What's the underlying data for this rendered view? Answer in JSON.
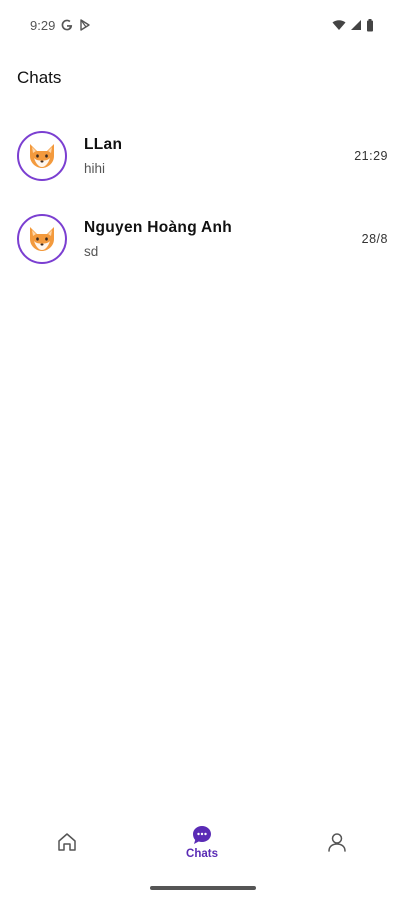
{
  "status_bar": {
    "time": "9:29",
    "left_icons": [
      "google-g-icon",
      "play-store-icon"
    ],
    "right_icons": [
      "wifi-icon",
      "signal-icon",
      "battery-icon"
    ]
  },
  "page": {
    "title": "Chats"
  },
  "chats": [
    {
      "name": "LLan",
      "preview": "hihi",
      "time": "21:29",
      "avatar": "fox-avatar"
    },
    {
      "name": "Nguyen Hoàng Anh",
      "preview": "sd",
      "time": "28/8",
      "avatar": "fox-avatar"
    }
  ],
  "bottom_nav": {
    "items": [
      {
        "icon": "home-icon",
        "label": "",
        "active": false
      },
      {
        "icon": "chat-bubble-icon",
        "label": "Chats",
        "active": true
      },
      {
        "icon": "profile-icon",
        "label": "",
        "active": false
      }
    ]
  },
  "colors": {
    "accent": "#5a2bb5",
    "avatar_ring": "#7b3fd1",
    "background": "#ffffff"
  }
}
